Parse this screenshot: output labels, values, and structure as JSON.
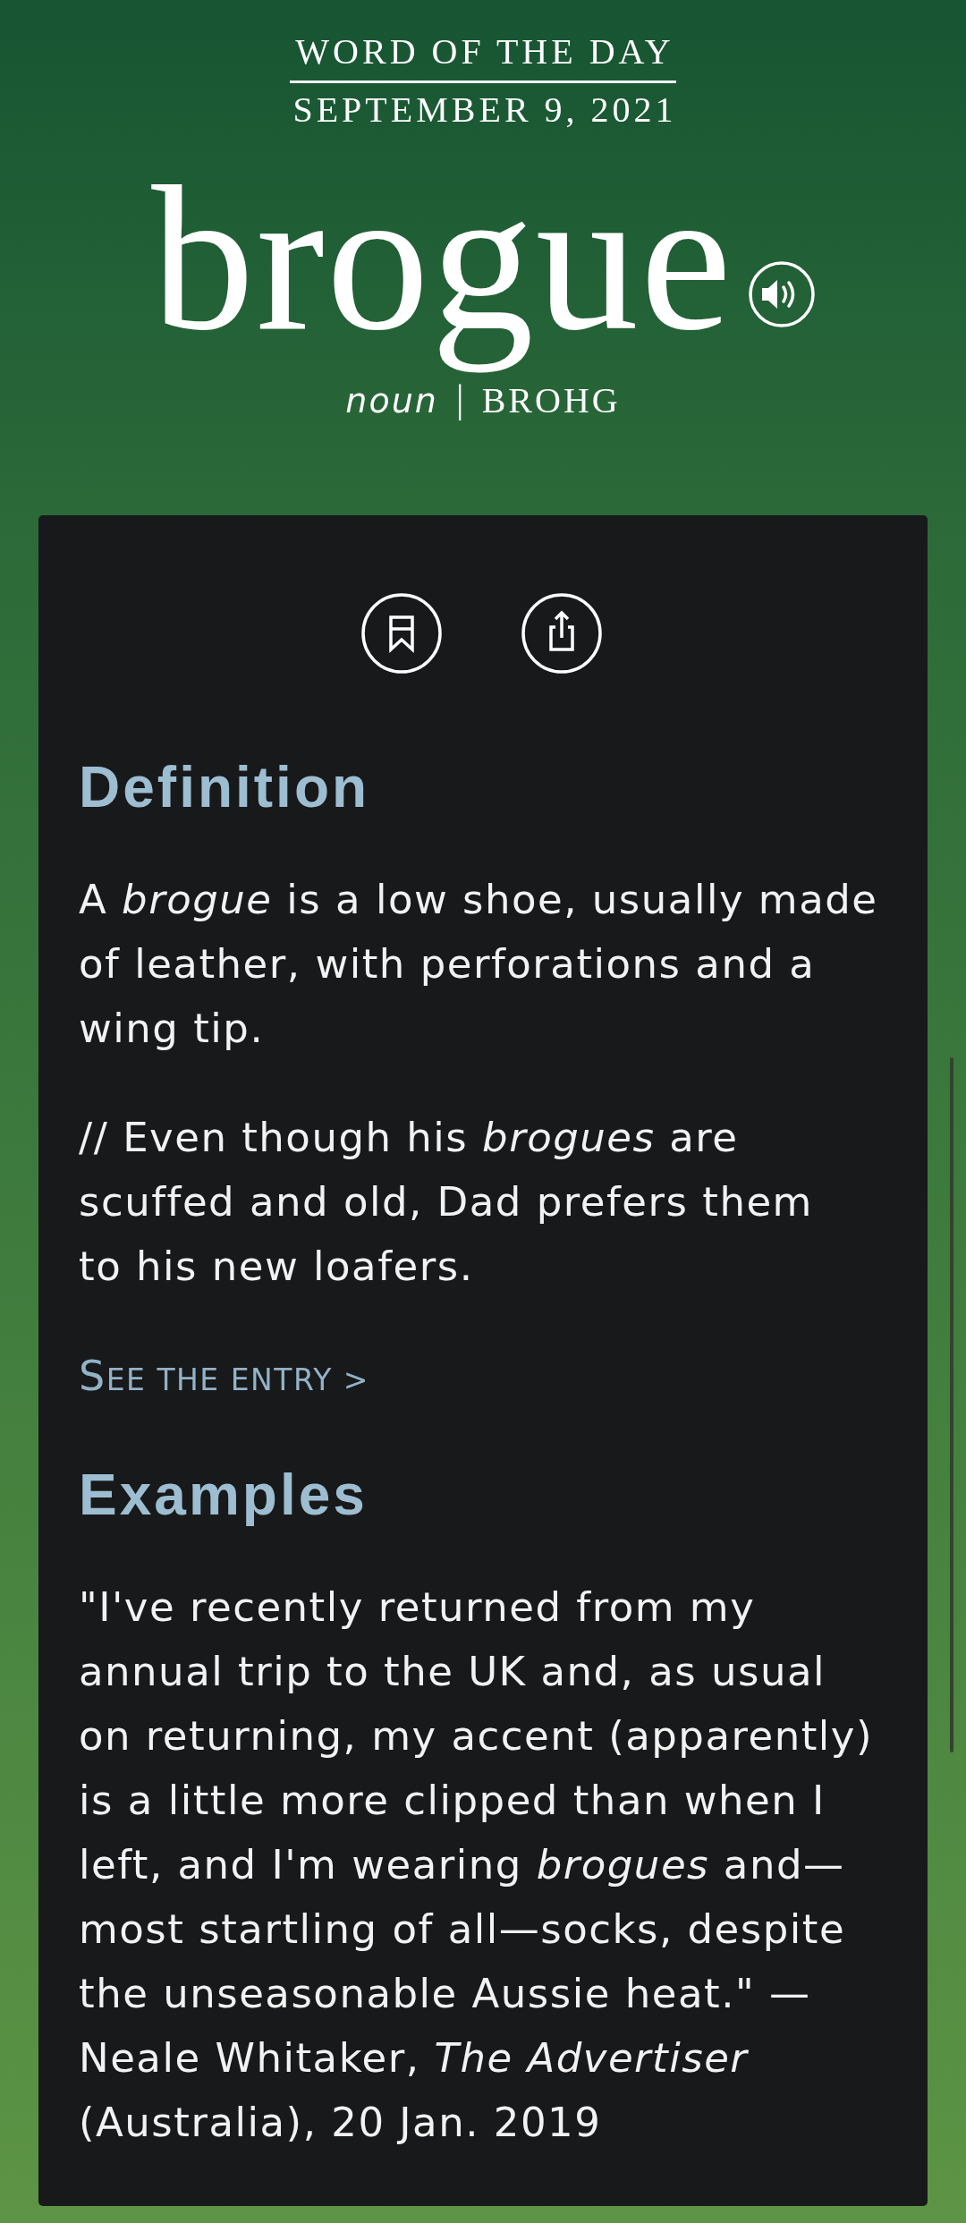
{
  "header": {
    "label": "WORD OF THE DAY",
    "date": "SEPTEMBER 9, 2021",
    "word": "brogue",
    "part_of_speech": "noun",
    "separator": "|",
    "pronunciation": "BROHG"
  },
  "definition": {
    "heading": "Definition",
    "text": "A *brogue* is a low shoe, usually made of leather, with perforations and a wing tip.",
    "example": "// Even though his *brogues* are scuffed and old, Dad prefers them to his new loafers.",
    "link": "SEE THE ENTRY >"
  },
  "examples": {
    "heading": "Examples",
    "quote": "\"I've recently returned from my annual trip to the UK and, as usual on returning, my accent (apparently) is a little more clipped than when I left, and I'm wearing *brogues* and—most startling of all—socks, despite the unseasonable Aussie heat.\" — Neale Whitaker, *The Advertiser* (Australia), 20 Jan. 2019"
  }
}
